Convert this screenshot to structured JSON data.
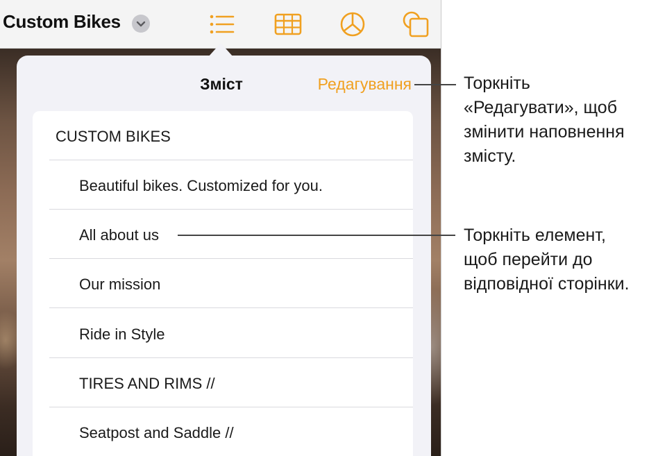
{
  "toolbar": {
    "doc_title": "Custom Bikes",
    "icons": [
      "chevron-down-icon",
      "list-icon",
      "table-icon",
      "pie-chart-icon",
      "shapes-icon"
    ],
    "accent_color": "#f0a020"
  },
  "toc_popover": {
    "title": "Зміст",
    "edit_label": "Редагування",
    "items": [
      "CUSTOM  BIKES",
      "Beautiful bikes. Customized for you.",
      "All about us",
      "Our mission",
      "Ride in Style",
      "TIRES AND RIMS //",
      "Seatpost and Saddle //"
    ]
  },
  "callouts": {
    "edit": [
      "Торкніть",
      "«Редагувати», щоб",
      "змінити наповнення",
      "змісту."
    ],
    "item": [
      "Торкніть елемент,",
      "щоб перейти до",
      "відповідної сторінки."
    ]
  }
}
